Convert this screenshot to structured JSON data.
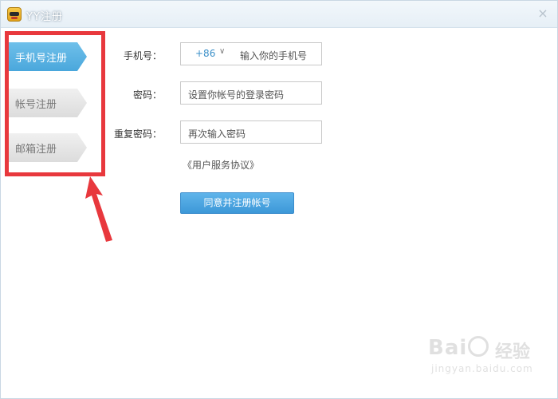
{
  "window": {
    "title": "YY注册",
    "close_glyph": "×"
  },
  "sidebar": {
    "items": [
      {
        "label": "手机号注册",
        "state": "active"
      },
      {
        "label": "帐号注册",
        "state": "inactive"
      },
      {
        "label": "邮箱注册",
        "state": "inactive"
      }
    ]
  },
  "form": {
    "phone": {
      "label": "手机号：",
      "country_code": "+86",
      "chevron": "∨",
      "placeholder": "输入你的手机号"
    },
    "password": {
      "label": "密码：",
      "placeholder": "设置你帐号的登录密码"
    },
    "confirm": {
      "label": "重复密码：",
      "placeholder": "再次输入密码"
    },
    "agreement_link": "《用户服务协议》",
    "submit_label": "同意并注册帐号"
  },
  "watermark": {
    "brand": "Bai",
    "jingyan": "经验",
    "url": "jingyan.baidu.com"
  },
  "colors": {
    "accent": "#4aa7dc",
    "highlight": "#e8383d"
  }
}
